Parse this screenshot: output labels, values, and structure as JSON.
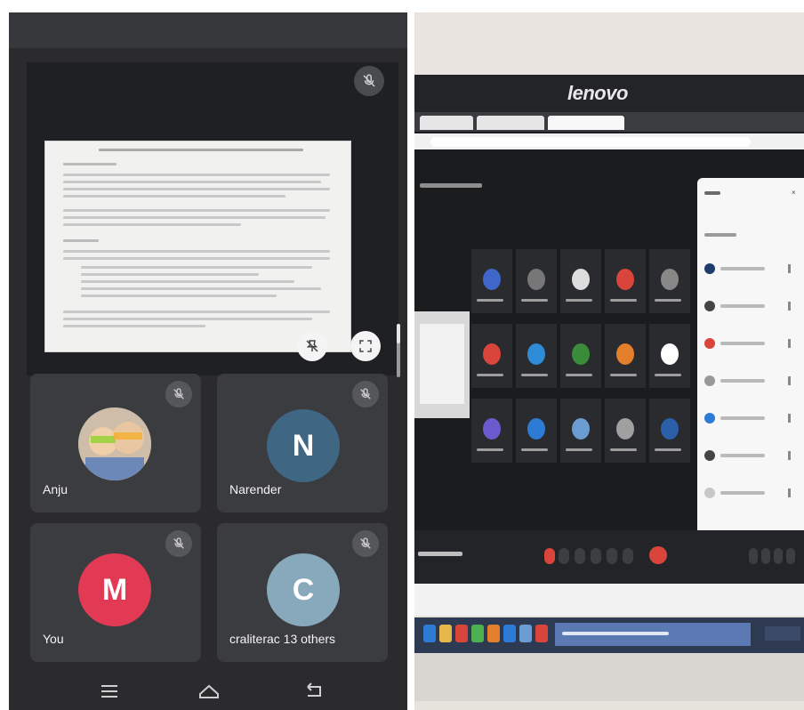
{
  "left_panel": {
    "tiles": [
      {
        "name": "Anju",
        "avatar_letter": "",
        "avatar_color": "#c9b9a6"
      },
      {
        "name": "Narender",
        "avatar_letter": "N",
        "avatar_color": "#3f6683"
      },
      {
        "name": "You",
        "avatar_letter": "M",
        "avatar_color": "#e23a55"
      },
      {
        "name": "craliterac 13 others",
        "avatar_letter": "C",
        "avatar_color": "#87a9bb"
      }
    ],
    "icons": {
      "mic_off": "mic-off-icon",
      "pin_off": "pin-off-icon",
      "fullscreen": "fullscreen-icon",
      "nav_menu": "menu-icon",
      "nav_home": "home-icon",
      "nav_back": "back-icon"
    }
  },
  "right_panel": {
    "monitor_brand": "lenovo",
    "grid_avatar_colors": [
      "#3f66c8",
      "#777",
      "#ddd",
      "#d9443b",
      "#888",
      "#d9443b",
      "#2e8bd6",
      "#3a8c3a",
      "#e37e2a",
      "#ffffff",
      "#6a5acd",
      "#2e7bd6",
      "#6a9bd1",
      "#a0a0a0",
      "#2b5fa8"
    ],
    "people_avatar_colors": [
      "#1f3b6b",
      "#444",
      "#d9443b",
      "#999",
      "#2e7bd6",
      "#444",
      "#c8c8c8"
    ],
    "taskbar_icon_colors": [
      "#2e7bd6",
      "#e6b84a",
      "#d9443b",
      "#4caf50",
      "#e37e2a",
      "#2e7bd6",
      "#6a9bd1",
      "#d9443b"
    ]
  }
}
